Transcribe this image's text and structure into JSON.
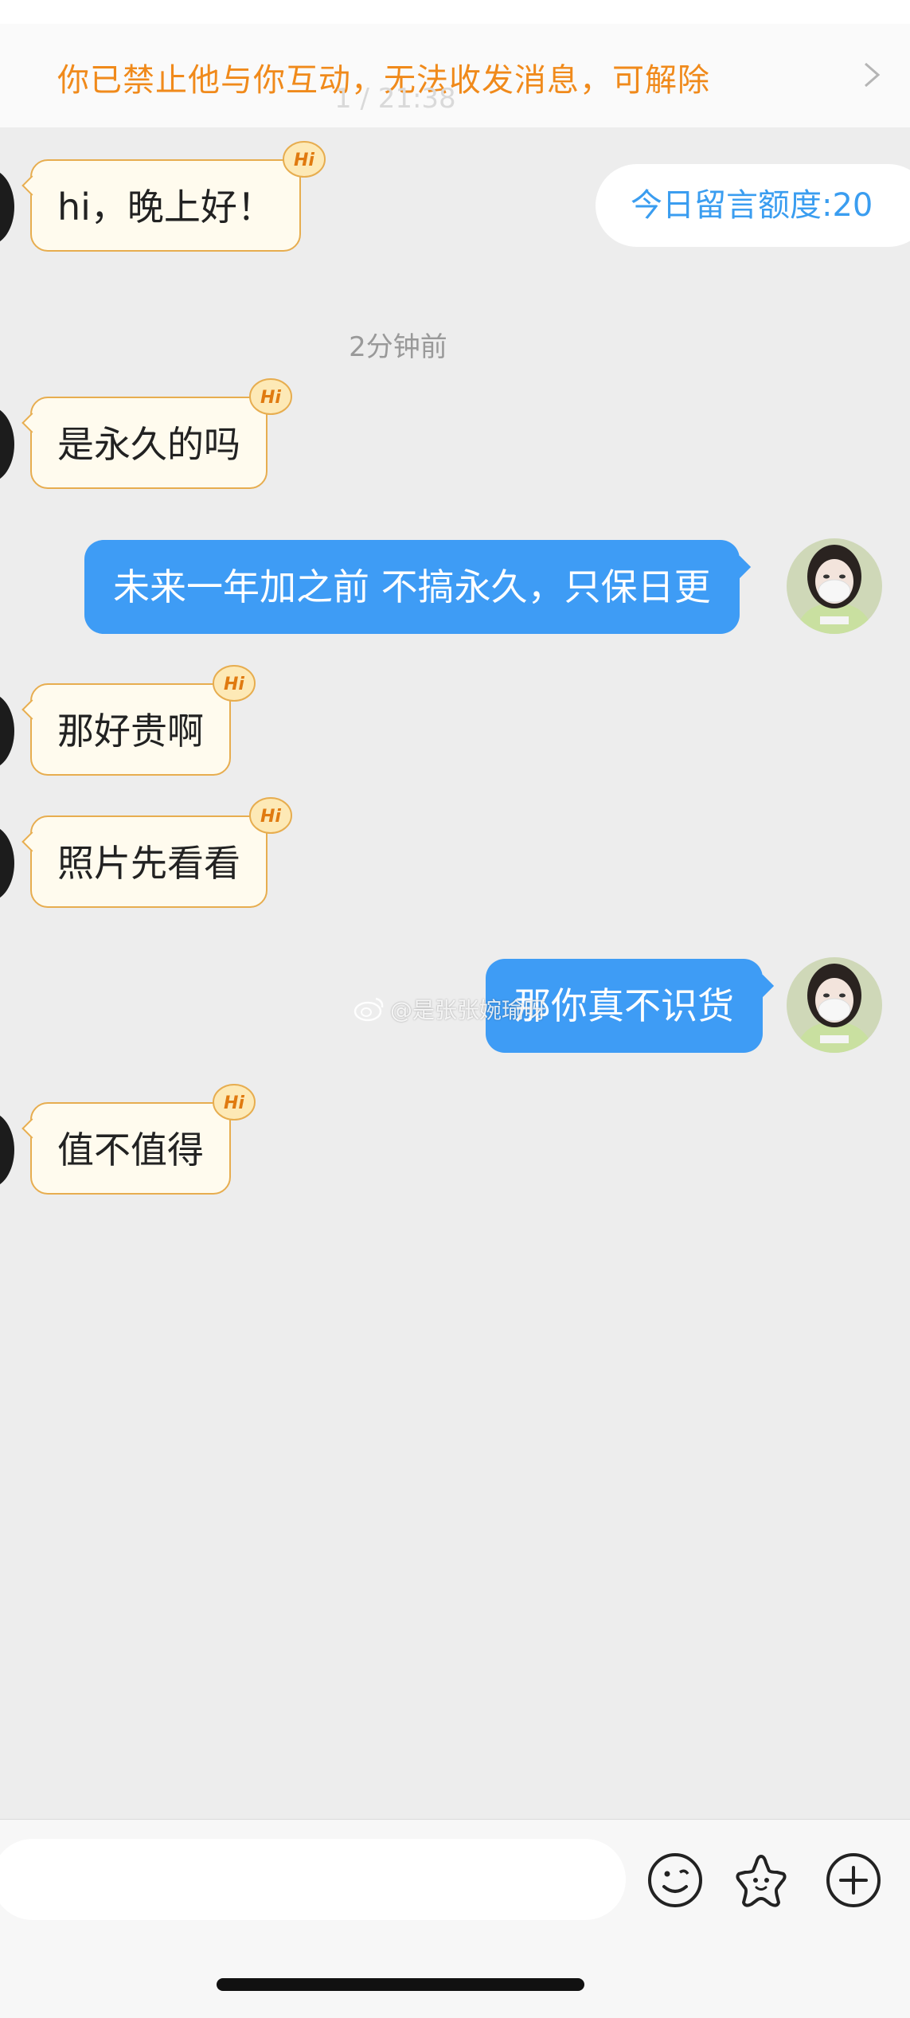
{
  "banner": {
    "text": "你已禁止他与你互动，无法收发消息，可解除",
    "icon": "chevron-right-icon"
  },
  "ghost_time": "1 / 21:38",
  "quota": {
    "label": "今日留言额度:20"
  },
  "messages": [
    {
      "direction": "in",
      "text": "hi，晚上好！"
    },
    {
      "type": "timestamp",
      "text": "2分钟前"
    },
    {
      "direction": "in",
      "text": "是永久的吗"
    },
    {
      "direction": "out",
      "text": "未来一年加之前 不搞永久，只保日更"
    },
    {
      "direction": "in",
      "text": "那好贵啊"
    },
    {
      "direction": "in",
      "text": "照片先看看"
    },
    {
      "direction": "out",
      "text": "那你真不识货"
    },
    {
      "direction": "in",
      "text": "值不值得"
    }
  ],
  "hi_badge": {
    "text": "Hi"
  },
  "watermark": {
    "text": "@是张张婉瑜呀"
  },
  "input": {
    "placeholder": "",
    "icons": [
      "emoji-icon",
      "sticker-star-icon",
      "add-icon"
    ]
  },
  "colors": {
    "banner_text": "#f08a1b",
    "accent_blue": "#3e9cf5",
    "incoming_bubble": "#fffbee",
    "incoming_border": "#e7ad4f",
    "background": "#ededed"
  }
}
